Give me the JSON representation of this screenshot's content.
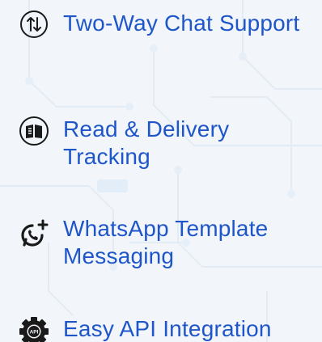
{
  "features": [
    {
      "icon": "arrows-updown-icon",
      "label": "Two-Way Chat Support"
    },
    {
      "icon": "book-icon",
      "label": "Read & Delivery Tracking"
    },
    {
      "icon": "whatsapp-add-icon",
      "label": "WhatsApp Template Messaging"
    },
    {
      "icon": "gear-api-icon",
      "label": "Easy API Integration"
    }
  ],
  "colors": {
    "text": "#1e56c9",
    "icon": "#1a1a1a",
    "background": "#f2f6fb"
  },
  "gear_badge_text": "API"
}
